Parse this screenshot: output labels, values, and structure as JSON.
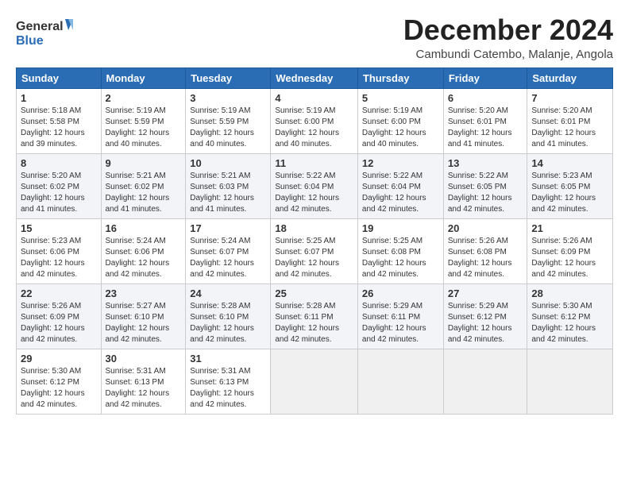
{
  "logo": {
    "line1": "General",
    "line2": "Blue"
  },
  "title": "December 2024",
  "subtitle": "Cambundi Catembo, Malanje, Angola",
  "weekdays": [
    "Sunday",
    "Monday",
    "Tuesday",
    "Wednesday",
    "Thursday",
    "Friday",
    "Saturday"
  ],
  "weeks": [
    [
      {
        "day": "1",
        "info": "Sunrise: 5:18 AM\nSunset: 5:58 PM\nDaylight: 12 hours\nand 39 minutes."
      },
      {
        "day": "2",
        "info": "Sunrise: 5:19 AM\nSunset: 5:59 PM\nDaylight: 12 hours\nand 40 minutes."
      },
      {
        "day": "3",
        "info": "Sunrise: 5:19 AM\nSunset: 5:59 PM\nDaylight: 12 hours\nand 40 minutes."
      },
      {
        "day": "4",
        "info": "Sunrise: 5:19 AM\nSunset: 6:00 PM\nDaylight: 12 hours\nand 40 minutes."
      },
      {
        "day": "5",
        "info": "Sunrise: 5:19 AM\nSunset: 6:00 PM\nDaylight: 12 hours\nand 40 minutes."
      },
      {
        "day": "6",
        "info": "Sunrise: 5:20 AM\nSunset: 6:01 PM\nDaylight: 12 hours\nand 41 minutes."
      },
      {
        "day": "7",
        "info": "Sunrise: 5:20 AM\nSunset: 6:01 PM\nDaylight: 12 hours\nand 41 minutes."
      }
    ],
    [
      {
        "day": "8",
        "info": "Sunrise: 5:20 AM\nSunset: 6:02 PM\nDaylight: 12 hours\nand 41 minutes."
      },
      {
        "day": "9",
        "info": "Sunrise: 5:21 AM\nSunset: 6:02 PM\nDaylight: 12 hours\nand 41 minutes."
      },
      {
        "day": "10",
        "info": "Sunrise: 5:21 AM\nSunset: 6:03 PM\nDaylight: 12 hours\nand 41 minutes."
      },
      {
        "day": "11",
        "info": "Sunrise: 5:22 AM\nSunset: 6:04 PM\nDaylight: 12 hours\nand 42 minutes."
      },
      {
        "day": "12",
        "info": "Sunrise: 5:22 AM\nSunset: 6:04 PM\nDaylight: 12 hours\nand 42 minutes."
      },
      {
        "day": "13",
        "info": "Sunrise: 5:22 AM\nSunset: 6:05 PM\nDaylight: 12 hours\nand 42 minutes."
      },
      {
        "day": "14",
        "info": "Sunrise: 5:23 AM\nSunset: 6:05 PM\nDaylight: 12 hours\nand 42 minutes."
      }
    ],
    [
      {
        "day": "15",
        "info": "Sunrise: 5:23 AM\nSunset: 6:06 PM\nDaylight: 12 hours\nand 42 minutes."
      },
      {
        "day": "16",
        "info": "Sunrise: 5:24 AM\nSunset: 6:06 PM\nDaylight: 12 hours\nand 42 minutes."
      },
      {
        "day": "17",
        "info": "Sunrise: 5:24 AM\nSunset: 6:07 PM\nDaylight: 12 hours\nand 42 minutes."
      },
      {
        "day": "18",
        "info": "Sunrise: 5:25 AM\nSunset: 6:07 PM\nDaylight: 12 hours\nand 42 minutes."
      },
      {
        "day": "19",
        "info": "Sunrise: 5:25 AM\nSunset: 6:08 PM\nDaylight: 12 hours\nand 42 minutes."
      },
      {
        "day": "20",
        "info": "Sunrise: 5:26 AM\nSunset: 6:08 PM\nDaylight: 12 hours\nand 42 minutes."
      },
      {
        "day": "21",
        "info": "Sunrise: 5:26 AM\nSunset: 6:09 PM\nDaylight: 12 hours\nand 42 minutes."
      }
    ],
    [
      {
        "day": "22",
        "info": "Sunrise: 5:26 AM\nSunset: 6:09 PM\nDaylight: 12 hours\nand 42 minutes."
      },
      {
        "day": "23",
        "info": "Sunrise: 5:27 AM\nSunset: 6:10 PM\nDaylight: 12 hours\nand 42 minutes."
      },
      {
        "day": "24",
        "info": "Sunrise: 5:28 AM\nSunset: 6:10 PM\nDaylight: 12 hours\nand 42 minutes."
      },
      {
        "day": "25",
        "info": "Sunrise: 5:28 AM\nSunset: 6:11 PM\nDaylight: 12 hours\nand 42 minutes."
      },
      {
        "day": "26",
        "info": "Sunrise: 5:29 AM\nSunset: 6:11 PM\nDaylight: 12 hours\nand 42 minutes."
      },
      {
        "day": "27",
        "info": "Sunrise: 5:29 AM\nSunset: 6:12 PM\nDaylight: 12 hours\nand 42 minutes."
      },
      {
        "day": "28",
        "info": "Sunrise: 5:30 AM\nSunset: 6:12 PM\nDaylight: 12 hours\nand 42 minutes."
      }
    ],
    [
      {
        "day": "29",
        "info": "Sunrise: 5:30 AM\nSunset: 6:12 PM\nDaylight: 12 hours\nand 42 minutes."
      },
      {
        "day": "30",
        "info": "Sunrise: 5:31 AM\nSunset: 6:13 PM\nDaylight: 12 hours\nand 42 minutes."
      },
      {
        "day": "31",
        "info": "Sunrise: 5:31 AM\nSunset: 6:13 PM\nDaylight: 12 hours\nand 42 minutes."
      },
      {
        "day": "",
        "info": ""
      },
      {
        "day": "",
        "info": ""
      },
      {
        "day": "",
        "info": ""
      },
      {
        "day": "",
        "info": ""
      }
    ]
  ]
}
